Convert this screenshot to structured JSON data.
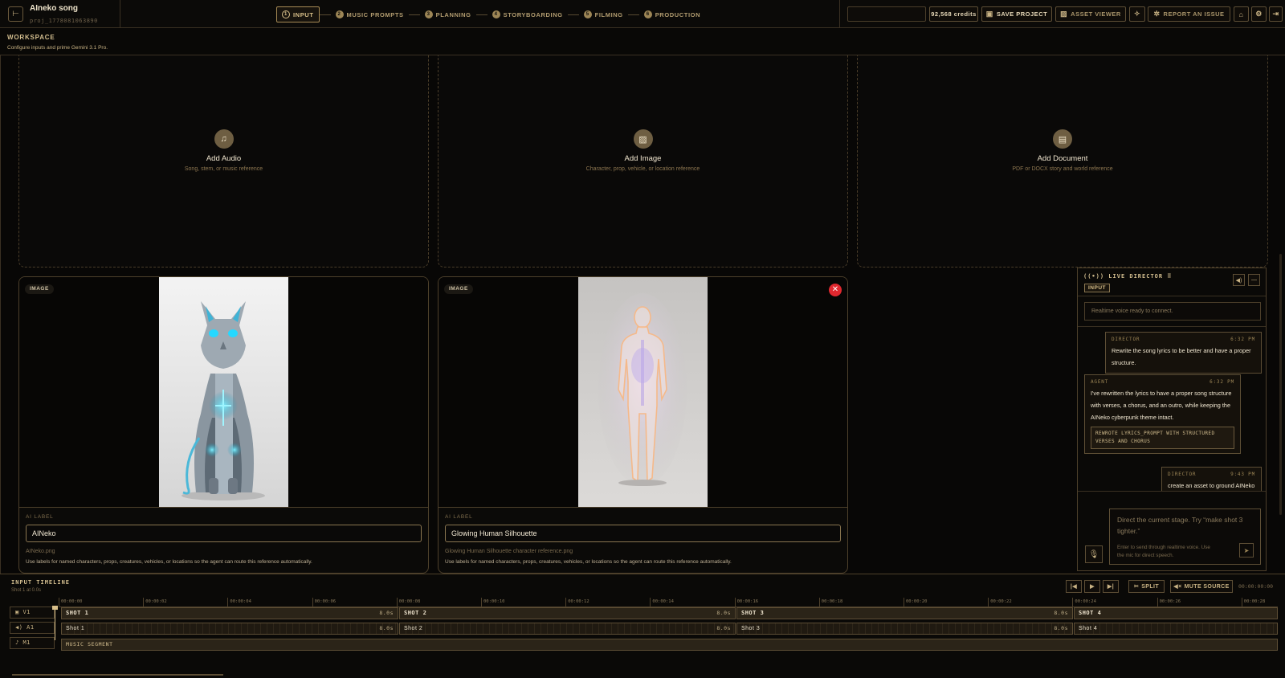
{
  "project": {
    "title": "AIneko song",
    "id": "proj_1778081063890"
  },
  "stages": [
    {
      "num": "1",
      "label": "INPUT",
      "active": true
    },
    {
      "num": "2",
      "label": "MUSIC PROMPTS"
    },
    {
      "num": "3",
      "label": "PLANNING"
    },
    {
      "num": "4",
      "label": "STORYBOARDING"
    },
    {
      "num": "5",
      "label": "FILMING"
    },
    {
      "num": "6",
      "label": "PRODUCTION"
    }
  ],
  "toolbar": {
    "credits": "92,568 credits",
    "save_label": "SAVE PROJECT",
    "asset_viewer_label": "ASSET VIEWER",
    "report_label": "REPORT AN ISSUE"
  },
  "workspace": {
    "title": "WORKSPACE",
    "subtitle": "Configure inputs and prime Gemini 3.1 Pro."
  },
  "dropzones": [
    {
      "title": "Add Audio",
      "subtitle": "Song, stem, or music reference",
      "icon": "music-note-icon"
    },
    {
      "title": "Add Image",
      "subtitle": "Character, prop, vehicle, or location reference",
      "icon": "image-icon"
    },
    {
      "title": "Add Document",
      "subtitle": "PDF or DOCX story and world reference",
      "icon": "document-icon"
    }
  ],
  "cards": [
    {
      "badge": "IMAGE",
      "ai_label_title": "AI LABEL",
      "label_value": "AINeko",
      "filename": "AINeko.png",
      "helper": "Use labels for named characters, props, creatures, vehicles, or locations so the agent can route this reference automatically."
    },
    {
      "badge": "IMAGE",
      "ai_label_title": "AI LABEL",
      "label_value": "Glowing Human Silhouette",
      "filename": "Glowing Human Silhouette character reference.png",
      "helper": "Use labels for named characters, props, creatures, vehicles, or locations so the agent can route this reference automatically."
    }
  ],
  "director": {
    "title": "LIVE DIRECTOR",
    "stage": "INPUT",
    "status": "Realtime voice ready to connect.",
    "messages": [
      {
        "role": "DIRECTOR",
        "time": "6:32 PM",
        "text": "Rewrite the song lyrics to be better and have a proper structure."
      },
      {
        "role": "AGENT",
        "time": "6:32 PM",
        "text": "I've rewritten the lyrics to have a proper song structure with verses, a chorus, and an outro, while keeping the AINeko cyberpunk theme intact.",
        "tool": "REWROTE LYRICS_PROMPT WITH STRUCTURED VERSES AND CHORUS"
      },
      {
        "role": "DIRECTOR",
        "time": "9:43 PM",
        "text": "create an asset to ground AINeko"
      }
    ],
    "placeholder": "Direct the current stage. Try “make shot 3 tighter.”",
    "hint": "Enter to send through realtime voice. Use the mic for direct speech."
  },
  "timeline": {
    "title": "INPUT TIMELINE",
    "subtitle": "Shot 1 at 0.0s",
    "split_label": "SPLIT",
    "mute_label": "MUTE SOURCE",
    "time": "00:00:00:00",
    "ticks": [
      "00:00:00",
      "00:00:02",
      "00:00:04",
      "00:00:06",
      "00:00:08",
      "00:00:10",
      "00:00:12",
      "00:00:14",
      "00:00:16",
      "00:00:18",
      "00:00:20",
      "00:00:22",
      "00:00:24",
      "00:00:26",
      "00:00:28"
    ],
    "tracks": [
      "V1",
      "A1",
      "M1"
    ],
    "video_clips": [
      {
        "label": "SHOT 1",
        "dur": "8.0s"
      },
      {
        "label": "SHOT 2",
        "dur": "8.0s"
      },
      {
        "label": "SHOT 3",
        "dur": "8.0s"
      },
      {
        "label": "SHOT 4",
        "dur": ""
      }
    ],
    "audio_clips": [
      {
        "label": "Shot 1",
        "dur": "8.0s"
      },
      {
        "label": "Shot 2",
        "dur": "8.0s"
      },
      {
        "label": "Shot 3",
        "dur": "8.0s"
      },
      {
        "label": "Shot 4",
        "dur": ""
      }
    ],
    "music_label": "MUSIC SEGMENT"
  }
}
